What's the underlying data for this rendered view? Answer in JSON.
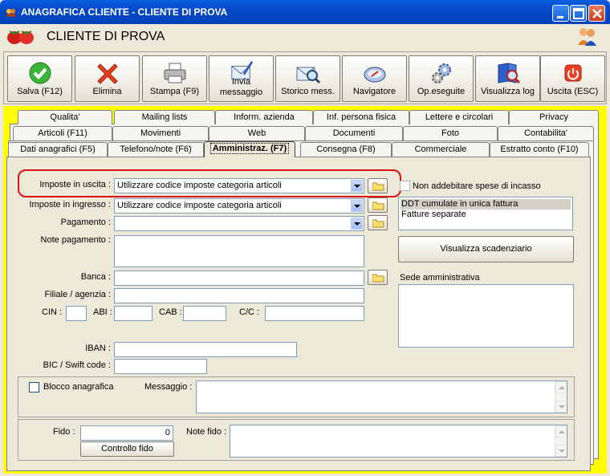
{
  "window": {
    "title": "ANAGRAFICA CLIENTE - CLIENTE DI PROVA"
  },
  "header": {
    "title": "CLIENTE DI PROVA"
  },
  "toolbar": {
    "buttons": [
      {
        "label": "Salva (F12)",
        "icon": "check-icon"
      },
      {
        "label": "Elimina",
        "icon": "delete-x-icon"
      },
      {
        "label": "Stampa (F9)",
        "icon": "printer-icon"
      },
      {
        "label": "Invia messaggio",
        "icon": "envelope-pen-icon"
      },
      {
        "label": "Storico mess.",
        "icon": "envelope-magnifier-icon"
      },
      {
        "label": "Navigatore",
        "icon": "compass-icon"
      },
      {
        "label": "Op.eseguite",
        "icon": "gears-icon"
      },
      {
        "label": "Visualizza log",
        "icon": "book-magnifier-icon"
      },
      {
        "label": "Uscita (ESC)",
        "icon": "power-icon"
      }
    ]
  },
  "tabs": {
    "row1": [
      "Qualita'",
      "Mailing lists",
      "Inform. azienda",
      "Inf. persona fisica",
      "Lettere e circolari",
      "Privacy"
    ],
    "row2": [
      "Articoli (F11)",
      "Movimenti",
      "Web",
      "Documenti",
      "Foto",
      "Contabilita'"
    ],
    "row3": [
      "Dati anagrafici (F5)",
      "Telefono/note (F6)",
      "Amministraz. (F7)",
      "Consegna (F8)",
      "Commerciale",
      "Estratto conto (F10)"
    ],
    "active": "Amministraz. (F7)"
  },
  "form": {
    "imposte_uscita": {
      "label": "Imposte in uscita :",
      "value": "Utilizzare codice imposte categoria articoli"
    },
    "imposte_ingresso": {
      "label": "Imposte in ingresso :",
      "value": "Utilizzare codice imposte categoria articoli"
    },
    "pagamento": {
      "label": "Pagamento :",
      "value": ""
    },
    "note_pagamento": {
      "label": "Note pagamento :",
      "value": ""
    },
    "banca": {
      "label": "Banca :",
      "value": ""
    },
    "filiale": {
      "label": "Filiale / agenzia :",
      "value": ""
    },
    "cin": {
      "label": "CIN :",
      "value": ""
    },
    "abi": {
      "label": "ABI :",
      "value": ""
    },
    "cab": {
      "label": "CAB :",
      "value": ""
    },
    "cc": {
      "label": "C/C :",
      "value": ""
    },
    "iban": {
      "label": "IBAN :",
      "value": ""
    },
    "bic": {
      "label": "BIC / Swift code :",
      "value": ""
    },
    "non_addebitare": {
      "label": "Non addebitare spese di incasso",
      "checked": false
    },
    "fatturazione_options": [
      "DDT cumulate in unica fattura",
      "Fatture separate"
    ],
    "fatturazione_selected": "DDT cumulate in unica fattura",
    "visualizza_scadenziario": "Visualizza scadenziario",
    "sede_amministrativa": {
      "label": "Sede amministrativa",
      "value": ""
    },
    "blocco": {
      "label": "Blocco anagrafica",
      "checked": false
    },
    "messaggio": {
      "label": "Messaggio :",
      "value": ""
    },
    "fido": {
      "label": "Fido :",
      "value": "0"
    },
    "controllo_fido": "Controllo fido",
    "note_fido": {
      "label": "Note fido :",
      "value": ""
    }
  },
  "colors": {
    "tab_area": "#FFFF00",
    "highlight": "#E01010",
    "titlebar": "#0A5FE0",
    "panel": "#ECE9D8"
  }
}
